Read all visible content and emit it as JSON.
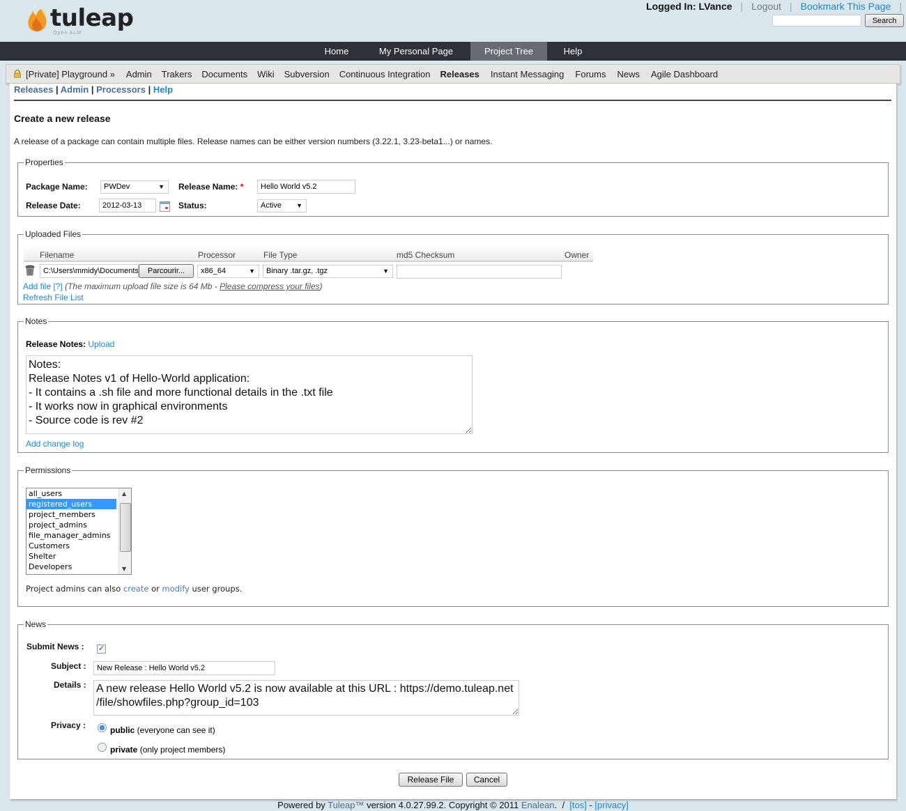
{
  "header": {
    "brand": "tuleap",
    "brand_sub": "Open ALM",
    "logged_in": "Logged In: LVance",
    "logout": "Logout",
    "bookmark": "Bookmark This Page",
    "search_value": "",
    "search_button": "Search"
  },
  "main_nav": [
    {
      "label": "Home"
    },
    {
      "label": "My Personal Page"
    },
    {
      "label": "Project Tree",
      "active": true
    },
    {
      "label": "Help"
    }
  ],
  "project_nav": {
    "project": "[Private] Playground »",
    "items": [
      "Admin",
      "Trakers",
      "Documents",
      "Wiki",
      "Subversion",
      "Continuous Integration",
      "Releases",
      "Instant Messaging",
      "Forums",
      "News",
      "Agile Dashboard"
    ],
    "current": "Releases"
  },
  "sub_nav": {
    "releases": "Releases",
    "admin": "Admin",
    "processors": "Processors",
    "help": "Help",
    "sep": "|"
  },
  "page": {
    "title": "Create a new release",
    "intro": "A release of a package can contain multiple files. Release names can be either version numbers (3.22.1, 3.23-beta1...) or names."
  },
  "properties": {
    "legend": "Properties",
    "package_label": "Package Name:",
    "package_value": "PWDev",
    "release_name_label": "Release Name:",
    "required_mark": "*",
    "release_name_value": "Hello World v5.2",
    "release_date_label": "Release Date:",
    "release_date_value": "2012-03-13",
    "status_label": "Status:",
    "status_value": "Active"
  },
  "uploaded_files": {
    "legend": "Uploaded Files",
    "columns": [
      "Filename",
      "Processor",
      "File Type",
      "md5 Checksum",
      "Owner"
    ],
    "row": {
      "filename": "C:\\Users\\mmidy\\Documents",
      "browse_button": "Parcourir...",
      "processor": "x86_64",
      "file_type": "Binary .tar.gz, .tgz",
      "md5": ""
    },
    "add_file": "Add file",
    "help_link": "[?]",
    "info_prefix": "(The maximum upload file size is 64 Mb - ",
    "info_link": "Please compress your files",
    "info_suffix": ")",
    "refresh": "Refresh File List"
  },
  "notes": {
    "legend": "Notes",
    "release_notes_label": "Release Notes:",
    "upload_link": "Upload",
    "text": "Notes:\nRelease Notes v1 of Hello-World application:\n- It contains a .sh file and more functional details in the .txt file\n- It works now in graphical environments\n- Source code is rev #2",
    "add_change_log": "Add change log"
  },
  "permissions": {
    "legend": "Permissions",
    "groups": [
      "all_users",
      "registered_users",
      "project_members",
      "project_admins",
      "file_manager_admins",
      "Customers",
      "Shelter",
      "Developers"
    ],
    "selected": "registered_users",
    "note_prefix": "Project admins can also ",
    "create_link": "create",
    "note_or": " or ",
    "modify_link": "modify",
    "note_suffix": " user groups."
  },
  "news": {
    "legend": "News",
    "submit_label": "Submit News :",
    "submit_checked": true,
    "subject_label": "Subject :",
    "subject_value": "New Release : Hello World v5.2",
    "details_label": "Details :",
    "details_value": "A new release Hello World v5.2 is now available at this URL : https://demo.tuleap.net\n/file/showfiles.php?group_id=103",
    "privacy_label": "Privacy :",
    "public_label": "public",
    "public_desc": " (everyone can see it)",
    "private_label": "private",
    "private_desc": " (only project members)",
    "privacy_value": "public"
  },
  "actions": {
    "release_button": "Release File",
    "cancel_button": "Cancel"
  },
  "footer": {
    "powered": "Powered by ",
    "tuleap": "Tuleap™",
    "version": " version 4.0.27.99.2. Copyright © 2011 ",
    "enalean": "Enalean",
    "dot_slash": ".  /  ",
    "tos": "[tos]",
    "dash": " - ",
    "privacy": "[privacy]"
  },
  "colors": {
    "background": "#d9e6ee",
    "nav_dark": "#2e3138",
    "nav_active": "#676b73",
    "link": "#1e88c7",
    "selected_option": "#3399ff"
  }
}
